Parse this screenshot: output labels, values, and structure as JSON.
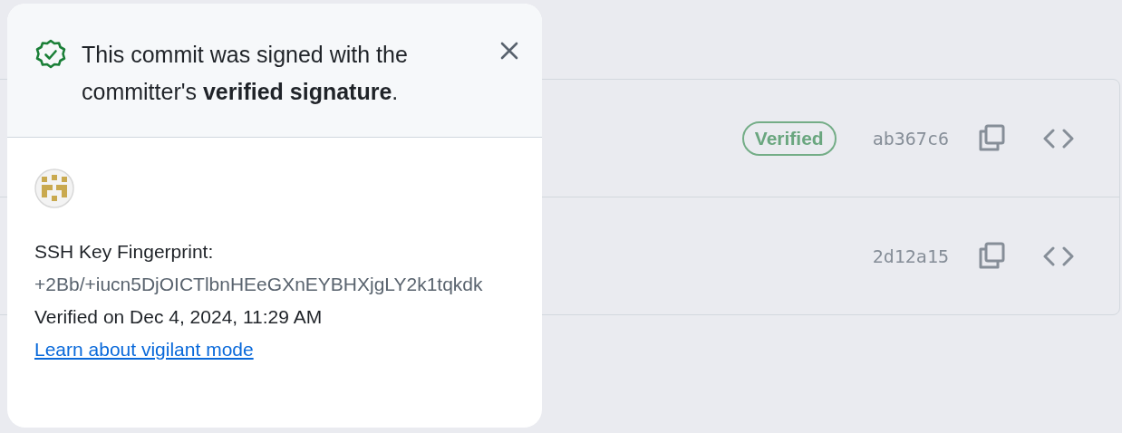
{
  "commits": [
    {
      "badge": "Verified",
      "sha": "ab367c6"
    },
    {
      "sha": "2d12a15"
    }
  ],
  "popover": {
    "message": "This commit was signed with the committer's **verified signature**.",
    "key_label": "SSH Key Fingerprint:",
    "fingerprint": "+2Bb/+iucn5DjOICTlbnHEeGXnEYBHXjgLY2k1tqkdk",
    "verified_on": "Verified on Dec 4, 2024, 11:29 AM",
    "link": "Learn about vigilant mode"
  }
}
